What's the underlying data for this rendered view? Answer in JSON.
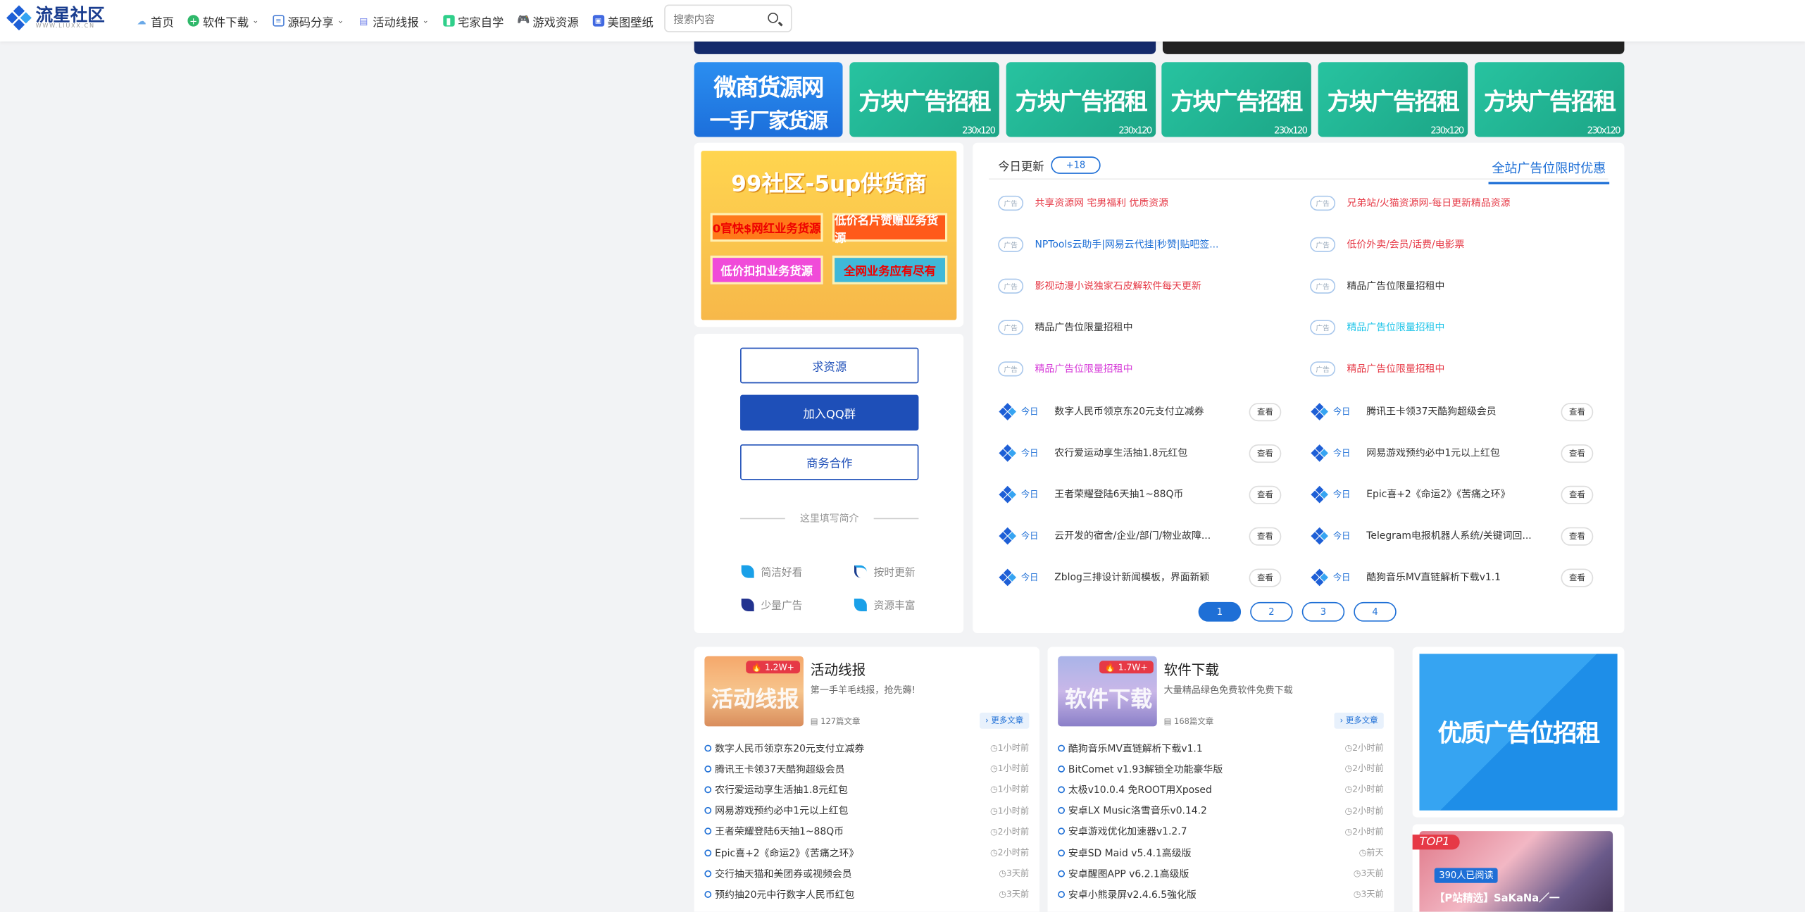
{
  "nav": {
    "logo_text": "流星社区",
    "logo_sub": "WWW.LIUXX.CN",
    "items": [
      {
        "label": "首页",
        "icon": "cloud-icon",
        "caret": false
      },
      {
        "label": "软件下载",
        "icon": "plus-circle-icon",
        "caret": true
      },
      {
        "label": "源码分享",
        "icon": "code-icon",
        "caret": true
      },
      {
        "label": "活动线报",
        "icon": "gift-icon",
        "caret": true
      },
      {
        "label": "宅家自学",
        "icon": "book-icon",
        "caret": false
      },
      {
        "label": "游戏资源",
        "icon": "gamepad-icon",
        "caret": false
      },
      {
        "label": "美图壁纸",
        "icon": "image-icon",
        "caret": false
      }
    ],
    "search_placeholder": "搜索内容"
  },
  "ads": {
    "weishang_line1": "微商货源网",
    "weishang_line2": "一手厂家货源",
    "square_label": "方块广告招租",
    "square_size": "230x120",
    "supplier_title": "99社区-5up供货商",
    "supplier_tags": [
      "0官快$网红业务货源",
      "低价名片赞赠业务货源",
      "低价扣扣业务货源",
      "全网业务应有尽有"
    ],
    "premium_side": "优质广告位招租"
  },
  "sidebar_card": {
    "btn_request": "求资源",
    "btn_qq": "加入QQ群",
    "btn_business": "商务合作",
    "intro": "这里填写简介",
    "features": [
      "简洁好看",
      "按时更新",
      "少量广告",
      "资源丰富"
    ]
  },
  "updates": {
    "today_label": "今日更新",
    "today_count": "+18",
    "all_tab": "全站广告位限时优惠",
    "ad_tag": "广告",
    "ad_rows": [
      {
        "text": "共享资源网 宅男福利 优质资源",
        "color": "#e63946"
      },
      {
        "text": "兄弟站/火猫资源网-每日更新精品资源",
        "color": "#e63946"
      },
      {
        "text": "NPTools云助手|网易云代挂|秒赞|贴吧签...",
        "color": "#1e6fd6"
      },
      {
        "text": "低价外卖/会员/话费/电影票",
        "color": "#e63946"
      },
      {
        "text": "影视动漫小说独家石皮解软件每天更新",
        "color": "#e63946"
      },
      {
        "text": "精品广告位限量招租中",
        "color": "#333333"
      },
      {
        "text": "精品广告位限量招租中",
        "color": "#333333"
      },
      {
        "text": "精品广告位限量招租中",
        "color": "#1ec4e8"
      },
      {
        "text": "精品广告位限量招租中",
        "color": "#d63ad8"
      },
      {
        "text": "精品广告位限量招租中",
        "color": "#e63946"
      }
    ],
    "today_tag": "今日",
    "look_label": "查看",
    "news_rows": [
      "数字人民币领京东20元支付立减券",
      "腾讯王卡领37天酷狗超级会员",
      "农行爱运动享生活抽1.8元红包",
      "网易游戏预约必中1元以上红包",
      "王者荣耀登陆6天抽1~88Q币",
      "Epic喜+2《命运2》《苦痛之环》",
      "云开发的宿舍/企业/部门/物业故障...",
      "Telegram电报机器人系统/关键词回...",
      "Zblog三排设计新闻模板，界面新颖",
      "酷狗音乐MV直链解析下载v1.1"
    ],
    "pages": [
      "1",
      "2",
      "3",
      "4"
    ]
  },
  "categories": [
    {
      "title": "活动线报",
      "desc": "第一手羊毛线报，抢先薅!",
      "hot": "1.2W+",
      "thumb_text": "活动线报",
      "count": "127篇文章",
      "more": "更多文章",
      "items": [
        {
          "t": "数字人民币领京东20元支付立减券",
          "time": "1小时前"
        },
        {
          "t": "腾讯王卡领37天酷狗超级会员",
          "time": "1小时前"
        },
        {
          "t": "农行爱运动享生活抽1.8元红包",
          "time": "1小时前"
        },
        {
          "t": "网易游戏预约必中1元以上红包",
          "time": "1小时前"
        },
        {
          "t": "王者荣耀登陆6天抽1~88Q币",
          "time": "2小时前"
        },
        {
          "t": "Epic喜+2《命运2》《苦痛之环》",
          "time": "2小时前"
        },
        {
          "t": "交行抽天猫和美团券或视频会员",
          "time": "3天前"
        },
        {
          "t": "预约抽20元中行数字人民币红包",
          "time": "3天前"
        }
      ]
    },
    {
      "title": "软件下载",
      "desc": "大量精品绿色免费软件免费下载",
      "hot": "1.7W+",
      "thumb_text": "软件下载",
      "count": "168篇文章",
      "more": "更多文章",
      "items": [
        {
          "t": "酷狗音乐MV直链解析下载v1.1",
          "time": "2小时前"
        },
        {
          "t": "BitComet v1.93解锁全功能豪华版",
          "time": "2小时前"
        },
        {
          "t": "太极v10.0.4 免ROOT用Xposed",
          "time": "2小时前"
        },
        {
          "t": "安卓LX Music洛雪音乐v0.14.2",
          "time": "2小时前"
        },
        {
          "t": "安卓游戏优化加速器v1.2.7",
          "time": "2小时前"
        },
        {
          "t": "安卓SD Maid v5.4.1高级版",
          "time": "前天"
        },
        {
          "t": "安卓醒图APP v6.2.1高级版",
          "time": "3天前"
        },
        {
          "t": "安卓小熊录屏v2.4.6.5強化版",
          "time": "3天前"
        }
      ]
    }
  ],
  "top_card": {
    "rank": "TOP1",
    "views": "390人已阅读",
    "title": "【P站精选】SaKaNa／一"
  }
}
